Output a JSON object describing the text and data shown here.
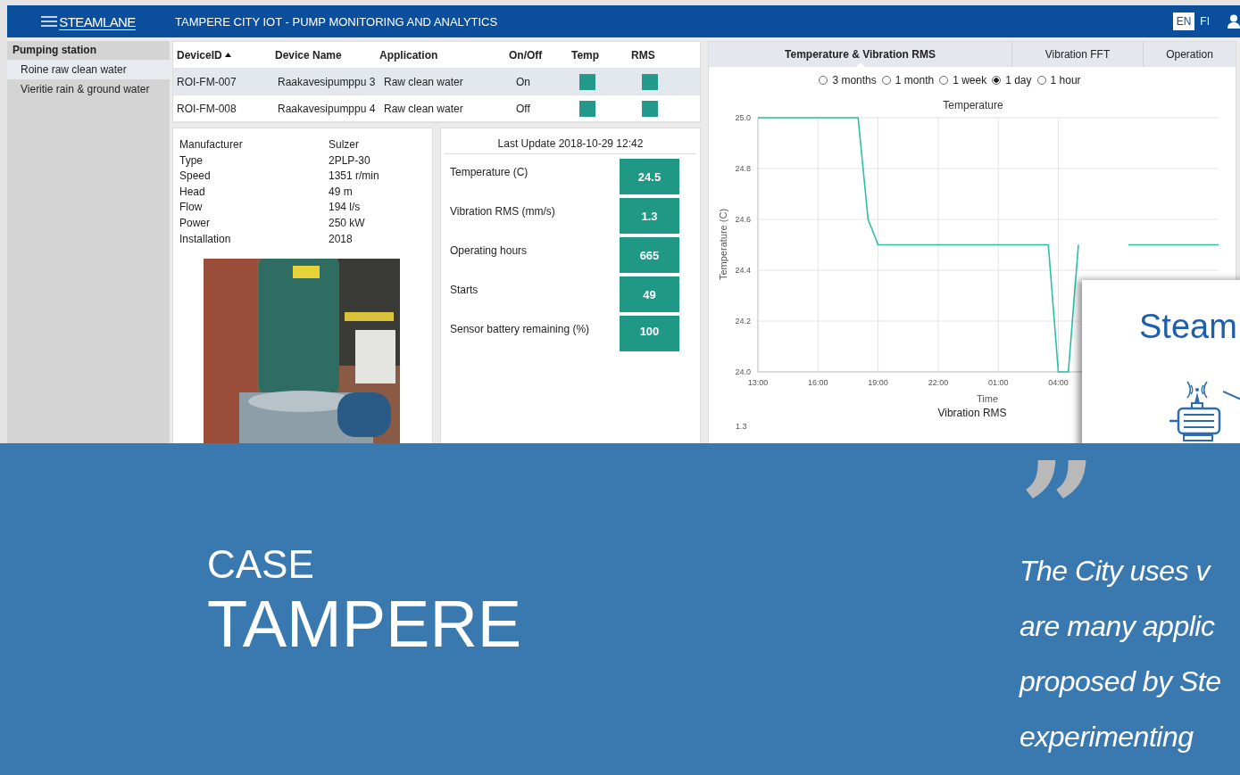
{
  "header": {
    "logo": "STEAMLANE",
    "title": "TAMPERE CITY IOT - PUMP MONITORING AND ANALYTICS",
    "languages": [
      {
        "label": "EN",
        "selected": true
      },
      {
        "label": "FI",
        "selected": false
      }
    ]
  },
  "sidebar": {
    "title": "Pumping station",
    "items": [
      {
        "label": "Roine raw clean water",
        "selected": true
      },
      {
        "label": "Vieritie rain & ground water",
        "selected": false
      }
    ]
  },
  "table": {
    "columns": [
      {
        "label": "DeviceID",
        "sorted": true
      },
      {
        "label": "Device Name",
        "sorted": false
      },
      {
        "label": "Application",
        "sorted": false
      },
      {
        "label": "On/Off",
        "sorted": false
      },
      {
        "label": "Temp",
        "sorted": false
      },
      {
        "label": "RMS",
        "sorted": false
      }
    ],
    "rows": [
      {
        "device_id": "ROI-FM-007",
        "device_name": "Raakavesipumppu 3",
        "application": "Raw clean water",
        "on_off": "On",
        "selected": true
      },
      {
        "device_id": "ROI-FM-008",
        "device_name": "Raakavesipumppu 4",
        "application": "Raw clean water",
        "on_off": "Off",
        "selected": false
      }
    ]
  },
  "details": {
    "rows": [
      {
        "label": "Manufacturer",
        "value": "Sulzer"
      },
      {
        "label": "Type",
        "value": "2PLP-30"
      },
      {
        "label": "Speed",
        "value": "1351 r/min"
      },
      {
        "label": "Head",
        "value": "49 m"
      },
      {
        "label": "Flow",
        "value": "194 l/s"
      },
      {
        "label": "Power",
        "value": "250 kW"
      },
      {
        "label": "Installation",
        "value": "2018"
      }
    ]
  },
  "metrics": {
    "last_update": "Last Update 2018-10-29 12:42",
    "items": [
      {
        "label": "Temperature (C)",
        "value": "24.5"
      },
      {
        "label": "Vibration RMS (mm/s)",
        "value": "1.3"
      },
      {
        "label": "Operating hours",
        "value": "665"
      },
      {
        "label": "Starts",
        "value": "49"
      },
      {
        "label": "Sensor battery remaining (%)",
        "value": "100"
      }
    ]
  },
  "charts_panel": {
    "tabs": [
      {
        "label": "Temperature & Vibration RMS",
        "selected": true
      },
      {
        "label": "Vibration FFT",
        "selected": false
      },
      {
        "label": "Operation",
        "selected": false
      }
    ],
    "ranges": [
      {
        "label": "3 months",
        "selected": false
      },
      {
        "label": "1 month",
        "selected": false
      },
      {
        "label": "1 week",
        "selected": false
      },
      {
        "label": "1 day",
        "selected": true
      },
      {
        "label": "1 hour",
        "selected": false
      }
    ],
    "temperature_chart": {
      "chart_data": {
        "type": "line",
        "title": "Temperature",
        "xlabel": "Time",
        "ylabel": "Temperature (C)",
        "categories": [
          "13:00",
          null,
          null,
          null,
          null,
          null,
          "16:00",
          null,
          null,
          null,
          null,
          null,
          "19:00",
          null,
          null,
          null,
          null,
          null,
          "22:00",
          null,
          null,
          null,
          null,
          null,
          "01:00",
          null,
          null,
          null,
          null,
          null,
          "04:00",
          null,
          null,
          null,
          null,
          null,
          null,
          null,
          null,
          null,
          null,
          null,
          null,
          null,
          null,
          null,
          null
        ],
        "series": [
          {
            "color": "#2bbfa8",
            "values": [
              25,
              25,
              25,
              25,
              25,
              25,
              25,
              25,
              25,
              25,
              25,
              24.6,
              24.5,
              24.5,
              24.5,
              24.5,
              24.5,
              24.5,
              24.5,
              24.5,
              24.5,
              24.5,
              24.5,
              24.5,
              24.5,
              24.5,
              24.5,
              24.5,
              24.5,
              24.5,
              24,
              24,
              24.5,
              null,
              null,
              null,
              null,
              24.5,
              24.5,
              24.5,
              24.5,
              24.5,
              24.5,
              24.5,
              24.5,
              24.5,
              24.5
            ]
          }
        ],
        "ylim": [
          24,
          25
        ],
        "grid": true,
        "yticks": [
          {
            "value": 24,
            "label": "24.0"
          },
          {
            "value": 24.2,
            "label": "24.2"
          },
          {
            "value": 24.4,
            "label": "24.4"
          },
          {
            "value": 24.6,
            "label": "24.6"
          },
          {
            "value": 24.8,
            "label": "24.8"
          },
          {
            "value": 25,
            "label": "25.0"
          }
        ]
      }
    },
    "vibration_chart": {
      "title": "Vibration RMS",
      "top_tick": "1.3"
    }
  },
  "slide": {
    "title": "Steam"
  },
  "banner": {
    "kicker": "CASE",
    "title": "TAMPERE",
    "quote_mark": "”",
    "quote_lines": [
      "The City uses v",
      "are many applic",
      "proposed by Ste",
      "experimenting"
    ]
  }
}
